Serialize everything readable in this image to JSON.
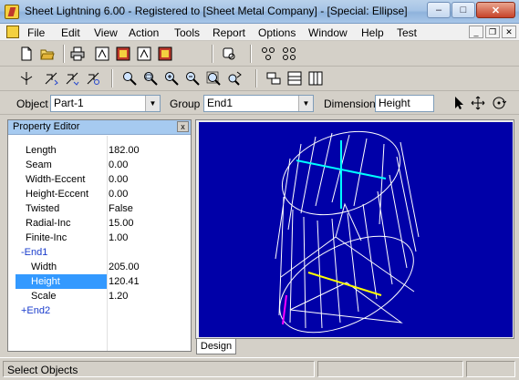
{
  "window": {
    "title": "Sheet Lightning 6.00 - Registered to [Sheet Metal Company] - [Special: Ellipse]",
    "minimize": "–",
    "maximize": "□",
    "close": "✕"
  },
  "menu": {
    "items": [
      "File",
      "Edit",
      "View",
      "Action",
      "Tools",
      "Report",
      "Options",
      "Window",
      "Help",
      "Test"
    ],
    "mdi_minimize": "_",
    "mdi_restore": "❐",
    "mdi_close": "✕"
  },
  "selectors": {
    "object_label": "Object",
    "object_value": "Part-1",
    "group_label": "Group",
    "group_value": "End1",
    "dimension_label": "Dimension",
    "dimension_value": "Height"
  },
  "property_editor": {
    "title": "Property Editor",
    "close": "x",
    "rows": [
      {
        "name": "Length",
        "value": "182.00"
      },
      {
        "name": "Seam",
        "value": "0.00"
      },
      {
        "name": "Width-Eccent",
        "value": "0.00"
      },
      {
        "name": "Height-Eccent",
        "value": "0.00"
      },
      {
        "name": "Twisted",
        "value": "False"
      },
      {
        "name": "Radial-Inc",
        "value": "15.00"
      },
      {
        "name": "Finite-Inc",
        "value": "1.00"
      },
      {
        "name": "-End1",
        "value": ""
      },
      {
        "name": "Width",
        "value": "205.00"
      },
      {
        "name": "Height",
        "value": "120.41"
      },
      {
        "name": "Scale",
        "value": "1.20"
      },
      {
        "name": "+End2",
        "value": ""
      }
    ],
    "selected_index": 9
  },
  "tabs": {
    "design": "Design"
  },
  "status": {
    "text": "Select Objects"
  },
  "colors": {
    "canvas": "#0000a8",
    "wire": "#ffffff",
    "accent_cyan": "#00ffff",
    "accent_yellow": "#ffff00",
    "accent_magenta": "#ff00ff"
  },
  "icons": {
    "toolbar1": [
      "new-icon",
      "open-icon",
      "print-icon",
      "report-icon-1",
      "report-icon-2",
      "report-icon-3",
      "report-icon-4",
      "preview-icon",
      "group-icon-1",
      "group-icon-2"
    ],
    "toolbar2": [
      "flat-pattern-icon",
      "rotate-x-icon",
      "rotate-y-icon",
      "rotate-z-icon",
      "zoom-icon",
      "zoom-window-icon",
      "zoom-in-icon",
      "zoom-out-icon",
      "zoom-extents-icon",
      "zoom-pan-icon",
      "layout-icon-1",
      "layout-icon-2",
      "layout-icon-3"
    ]
  }
}
